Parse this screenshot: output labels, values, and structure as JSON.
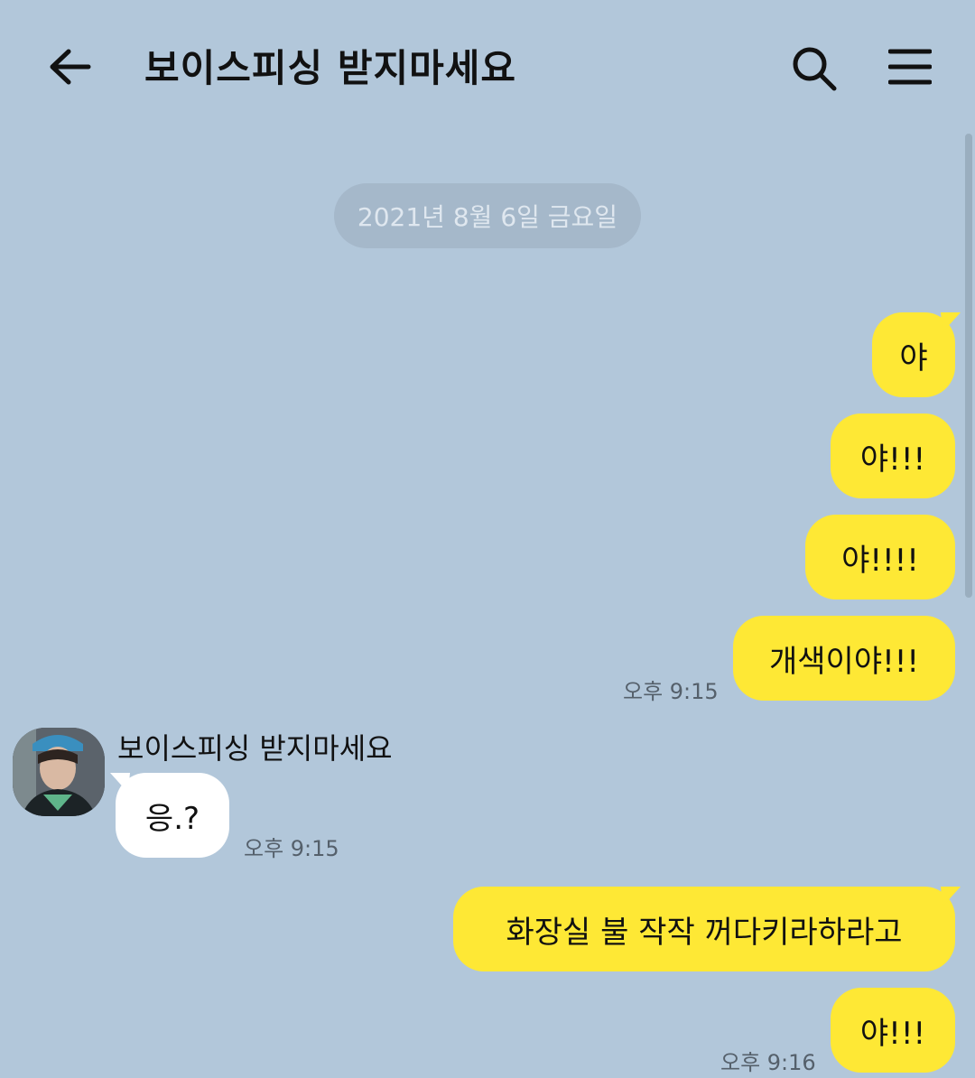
{
  "header": {
    "title": "보이스피싱 받지마세요",
    "back_icon": "arrow-left-icon",
    "search_icon": "search-icon",
    "menu_icon": "hamburger-menu-icon"
  },
  "chat": {
    "date_divider": "2021년 8월 6일 금요일",
    "messages": [
      {
        "sender": "me",
        "text": "야"
      },
      {
        "sender": "me",
        "text": "야!!!"
      },
      {
        "sender": "me",
        "text": "야!!!!"
      },
      {
        "sender": "me",
        "text": "개색이야!!!",
        "time": "오후 9:15"
      },
      {
        "sender": "other",
        "name": "보이스피싱 받지마세요",
        "text": "응.?",
        "time": "오후 9:15"
      },
      {
        "sender": "me",
        "text": "화장실 불 작작 꺼다키라하라고"
      },
      {
        "sender": "me",
        "text": "야!!!",
        "time": "오후 9:16"
      }
    ]
  },
  "colors": {
    "background": "#b2c7da",
    "my_bubble": "#fee835",
    "other_bubble": "#ffffff",
    "date_pill": "#a5b8ca"
  }
}
